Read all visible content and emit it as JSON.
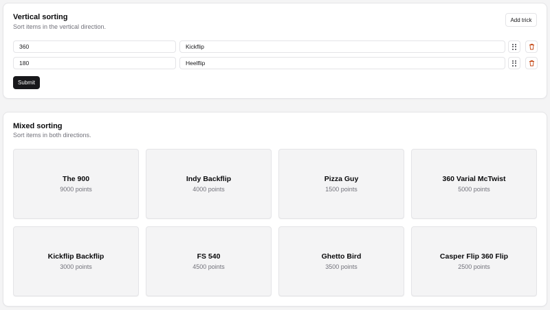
{
  "vertical": {
    "title": "Vertical sorting",
    "description": "Sort items in the vertical direction.",
    "add_label": "Add trick",
    "submit_label": "Submit",
    "rows": [
      {
        "points": "360",
        "name": "Kickflip"
      },
      {
        "points": "180",
        "name": "Heelflip"
      }
    ]
  },
  "mixed": {
    "title": "Mixed sorting",
    "description": "Sort items in both directions.",
    "tiles": [
      {
        "name": "The 900",
        "points": "9000 points"
      },
      {
        "name": "Indy Backflip",
        "points": "4000 points"
      },
      {
        "name": "Pizza Guy",
        "points": "1500 points"
      },
      {
        "name": "360 Varial McTwist",
        "points": "5000 points"
      },
      {
        "name": "Kickflip Backflip",
        "points": "3000 points"
      },
      {
        "name": "FS 540",
        "points": "4500 points"
      },
      {
        "name": "Ghetto Bird",
        "points": "3500 points"
      },
      {
        "name": "Casper Flip 360 Flip",
        "points": "2500 points"
      }
    ]
  },
  "icons": {
    "drag": "grip-vertical-icon",
    "delete": "trash-icon"
  },
  "colors": {
    "primary": "#18181b",
    "danger": "#c2410c",
    "tile_bg": "#f4f4f5"
  }
}
